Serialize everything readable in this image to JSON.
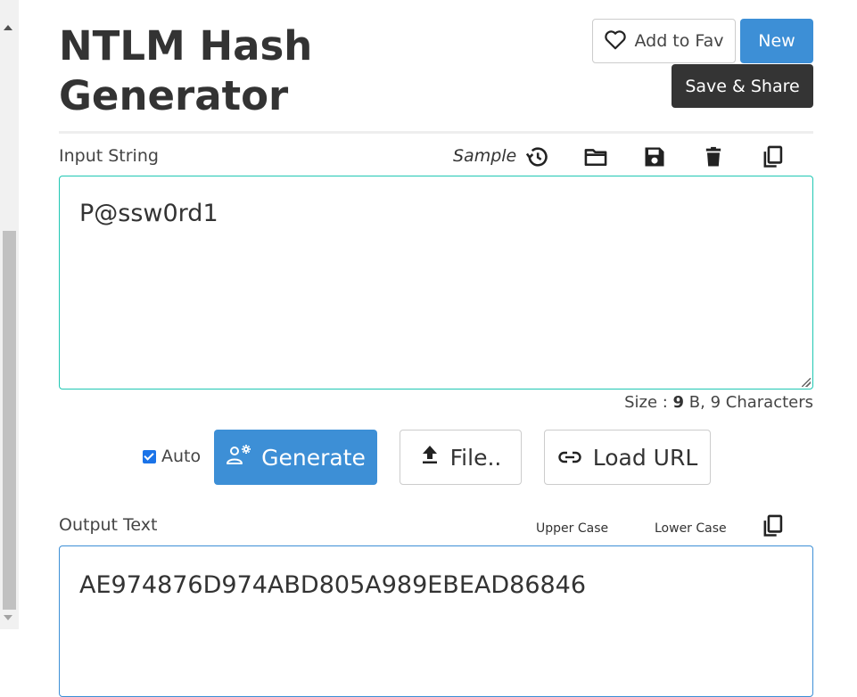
{
  "header": {
    "title": "NTLM Hash Generator",
    "add_fav_label": "Add to Fav",
    "new_label": "New",
    "save_share_label": "Save & Share"
  },
  "input": {
    "label": "Input String",
    "sample_label": "Sample",
    "value": "P@ssw0rd1",
    "size_prefix": "Size : ",
    "size_bytes": "9",
    "size_suffix": " B, 9 Characters"
  },
  "toolbar_icons": [
    "history-icon",
    "folder-open-icon",
    "save-icon",
    "trash-icon",
    "copy-icon"
  ],
  "actions": {
    "auto_label": "Auto",
    "auto_checked": true,
    "generate_label": "Generate",
    "file_label": "File..",
    "load_url_label": "Load URL"
  },
  "output": {
    "label": "Output Text",
    "upper_case_label": "Upper Case",
    "lower_case_label": "Lower Case",
    "value": "AE974876D974ABD805A989EBEAD86846"
  },
  "colors": {
    "primary": "#3d8fd6",
    "dark_button": "#343434",
    "input_border": "#1fc7b3",
    "output_border": "#3d8fd6"
  }
}
